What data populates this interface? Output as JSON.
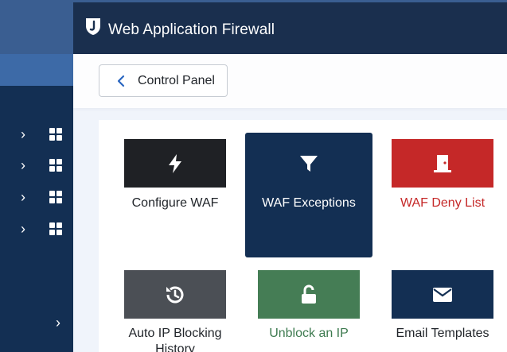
{
  "header": {
    "title": "Web Application Firewall",
    "logo_icon": "joomla-shield-logo"
  },
  "toolbar": {
    "back_label": "Control Panel",
    "back_icon": "chevron-left-icon"
  },
  "sidebar": {
    "items": [
      {
        "icon": "grid-icon"
      },
      {
        "icon": "grid-icon"
      },
      {
        "icon": "grid-icon"
      },
      {
        "icon": "grid-icon"
      }
    ],
    "collapse_icon": "chevron-right-icon"
  },
  "tiles": [
    {
      "label": "Configure WAF",
      "icon": "bolt-icon",
      "color": "#1f2125",
      "label_color": "#22262b",
      "active": false
    },
    {
      "label": "WAF Exceptions",
      "icon": "filter-icon",
      "color": "#132f53",
      "label_color": "#ffffff",
      "active": true
    },
    {
      "label": "WAF Deny List",
      "icon": "door-icon",
      "color": "#c52828",
      "label_color": "#c52828",
      "active": false
    },
    {
      "label": "Auto IP Blocking History",
      "icon": "history-icon",
      "color": "#4b4f55",
      "label_color": "#22262b",
      "active": false
    },
    {
      "label": "Unblock an IP",
      "icon": "unlock-icon",
      "color": "#457d55",
      "label_color": "#3d7a4f",
      "active": false
    },
    {
      "label": "Email Templates",
      "icon": "envelope-icon",
      "color": "#132f53",
      "label_color": "#22262b",
      "active": false
    }
  ],
  "colors": {
    "sidebar_bg": "#132f53",
    "header_bg": "#1a2f4e",
    "accent": "#2a66c0"
  }
}
